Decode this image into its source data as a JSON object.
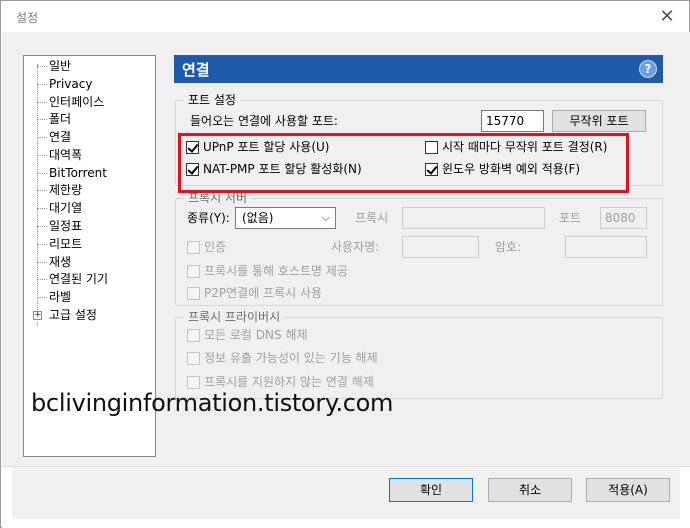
{
  "window": {
    "title": "설정",
    "close_glyph": "✕"
  },
  "sidebar": {
    "items": [
      {
        "label": "일반"
      },
      {
        "label": "Privacy"
      },
      {
        "label": "인터페이스"
      },
      {
        "label": "폴더"
      },
      {
        "label": "연결",
        "selected": true
      },
      {
        "label": "대역폭"
      },
      {
        "label": "BitTorrent"
      },
      {
        "label": "제한량"
      },
      {
        "label": "대기열"
      },
      {
        "label": "일정표"
      },
      {
        "label": "리모트"
      },
      {
        "label": "재생"
      },
      {
        "label": "연결된 기기"
      },
      {
        "label": "라벨"
      },
      {
        "label": "고급 설정",
        "expander": "+"
      }
    ]
  },
  "panel": {
    "title": "연결",
    "help_glyph": "?"
  },
  "port_settings": {
    "legend": "포트 설정",
    "incoming_label": "들어오는 연결에 사용할 포트:",
    "port_value": "15770",
    "random_port_button": "무작위 포트",
    "upnp_label": "UPnP 포트 할당 사용(U)",
    "upnp_checked": true,
    "random_on_start_label": "시작 때마다 무작위 포트 결정(R)",
    "random_on_start_checked": false,
    "natpmp_label": "NAT-PMP 포트 할당 활성화(N)",
    "natpmp_checked": true,
    "firewall_label": "윈도우 방화벽 예외 적용(F)",
    "firewall_checked": true
  },
  "proxy_server": {
    "legend": "프록시 서버",
    "type_label": "종류(Y):",
    "type_value": "(없음)",
    "proxy_label": "프록시",
    "port_label": "포트",
    "port_value": "8080",
    "auth_label": "인증",
    "username_label": "사용자명:",
    "password_label": "암호:",
    "hostname_label": "프록시를 통해 호스트명 제공",
    "p2p_label": "P2P연결에 프록시 사용"
  },
  "proxy_privacy": {
    "legend": "프록시 프라이버시",
    "dns_label": "모든 로컬 DNS 해제",
    "leak_label": "정보 유출 가능성이 있는 기능 해제",
    "unsupported_label": "프록시를 지원하지 않는 연결 해제"
  },
  "footer": {
    "ok_button": "확인",
    "cancel_button": "취소",
    "apply_button": "적용(A)"
  },
  "watermark": "bclivinginformation.tistory.com",
  "colors": {
    "header_blue": "#1e5aa8",
    "highlight_red": "#e0111c"
  }
}
